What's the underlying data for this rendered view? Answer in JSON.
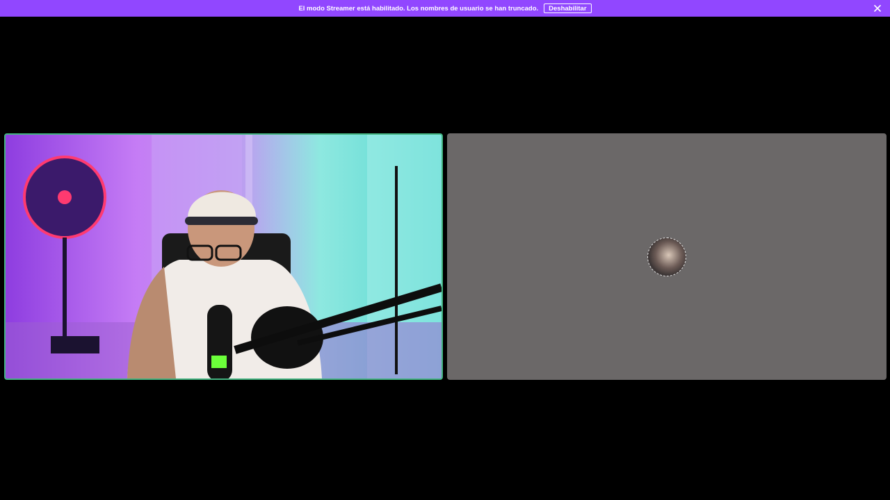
{
  "banner": {
    "message": "El modo Streamer está habilitado. Los nombres de usuario se han truncado.",
    "disable_label": "Deshabilitar",
    "background": "#9147ff",
    "close_icon": "close-icon"
  },
  "call": {
    "speaking_border_color": "#43b581",
    "participants": [
      {
        "type": "video",
        "speaking": true
      },
      {
        "type": "avatar",
        "speaking": false
      }
    ]
  }
}
